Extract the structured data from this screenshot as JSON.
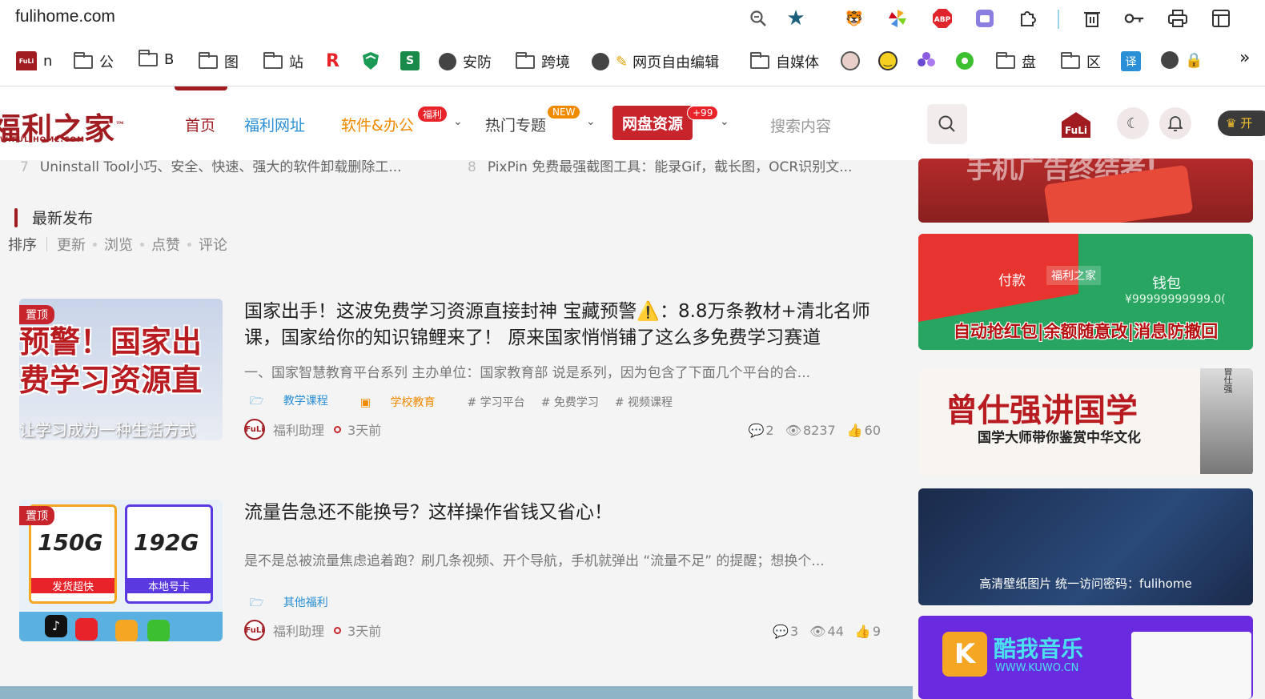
{
  "browser": {
    "url": "fulihome.com",
    "bookmarks": [
      "n",
      "公",
      "B",
      "图",
      "站",
      "安防",
      "跨境",
      "网页自由编辑",
      "自媒体",
      "盘",
      "区",
      "译"
    ],
    "more": "»"
  },
  "nav": {
    "logo": "福利之家",
    "logo_tm": "™",
    "logo_sub": "W.FULIHOME.COM",
    "items": [
      "首页",
      "福利网址",
      "软件&办公",
      "热门专题",
      "网盘资源"
    ],
    "badges": {
      "software": "福利",
      "topics": "NEW",
      "netdisk": "+99"
    },
    "search_placeholder": "搜索内容",
    "vip_label": "开"
  },
  "colors": {
    "brand": "#a01c20",
    "accent_blue": "#2a8fd6",
    "accent_orange": "#f08a00"
  },
  "prev_row": {
    "left": "Uninstall Tool小巧、安全、快速、强大的软件卸载删除工...",
    "right": "PixPin 免费最强截图工具：能录Gif，截长图，OCR识别文..."
  },
  "section": {
    "title": "最新发布",
    "sort_label": "排序",
    "sort_options": [
      "更新",
      "浏览",
      "点赞",
      "评论"
    ]
  },
  "posts": [
    {
      "pin": "置顶",
      "thumb_lines": [
        "预警！国家出",
        "费学习资源直"
      ],
      "thumb_caption": "让学习成为一种生活方式",
      "title": "国家出手！这波免费学习资源直接封神 宝藏预警⚠️：8.8万条教材+清北名师课，国家给你的知识锦鲤来了！ 原来国家悄悄铺了这么多免费学习赛道",
      "excerpt": "一、国家智慧教育平台系列 主办单位：国家教育部 说是系列，因为包含了下面几个平台的合...",
      "tags": [
        "教学课程",
        "学校教育",
        "# 学习平台",
        "# 免费学习",
        "# 视频课程"
      ],
      "author": "福利助理",
      "time": "3天前",
      "comments": "2",
      "views": "8237",
      "likes": "60"
    },
    {
      "pin": "置顶",
      "thumb_cards": [
        "150G",
        "192G"
      ],
      "thumb_labels": [
        "发货超快",
        "本地号卡"
      ],
      "title": "流量告急还不能换号？这样操作省钱又省心！",
      "excerpt": "是不是总被流量焦虑追着跑？刷几条视频、开个导航，手机就弹出 “流量不足” 的提醒；想换个...",
      "tags": [
        "其他福利"
      ],
      "author": "福利助理",
      "time": "3天前",
      "comments": "3",
      "views": "44",
      "likes": "9"
    }
  ],
  "sidebar": {
    "ad1_text": "手机广告终结者!",
    "ad2_text": "自动抢红包|余额随意改|消息防撤回",
    "ad2_wallet": "钱包",
    "ad2_amount": "¥99999999999.0(",
    "ad2_pay": "付款",
    "ad3_title": "曾仕强讲国学",
    "ad3_sub": "国学大师带你鉴赏中华文化",
    "ad3_name": "曾仕强",
    "ad4_caption": "高清壁纸图片 统一访问密码：fulihome",
    "ad5_title": "酷我音乐",
    "ad5_url": "WWW.KUWO.CN"
  }
}
